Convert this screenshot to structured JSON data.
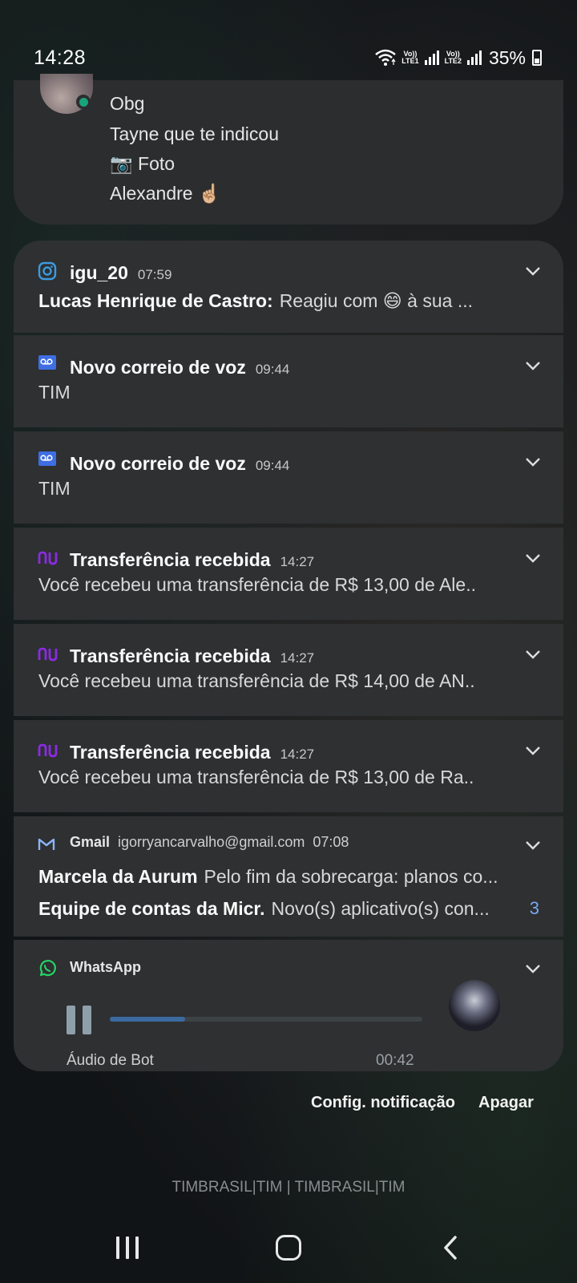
{
  "status_bar": {
    "time": "14:28",
    "lte1": "Vo))\nLTE1",
    "lte2": "Vo))\nLTE2",
    "battery": "35%"
  },
  "conversation": {
    "messages": [
      "Obg",
      "Tayne que te indicou",
      "📷 Foto",
      "Alexandre ☝🏼"
    ]
  },
  "notifications": [
    {
      "icon": "instagram-icon",
      "title": "igu_20",
      "time": "07:59",
      "sender": "Lucas Henrique de Castro:",
      "text": "Reagiu com 😄 à sua ..."
    },
    {
      "icon": "voicemail-icon",
      "title": "Novo correio de voz",
      "time": "09:44",
      "text": "TIM"
    },
    {
      "icon": "voicemail-icon",
      "title": "Novo correio de voz",
      "time": "09:44",
      "text": "TIM"
    },
    {
      "icon": "nubank-icon",
      "title": "Transferência recebida",
      "time": "14:27",
      "text": "Você recebeu uma transferência de R$ 13,00 de Ale.."
    },
    {
      "icon": "nubank-icon",
      "title": "Transferência recebida",
      "time": "14:27",
      "text": "Você recebeu uma transferência de R$ 14,00 de AN.."
    },
    {
      "icon": "nubank-icon",
      "title": "Transferência recebida",
      "time": "14:27",
      "text": "Você recebeu uma transferência de R$ 13,00 de Ra.."
    }
  ],
  "gmail": {
    "app": "Gmail",
    "account": "igorryancarvalho@gmail.com",
    "time": "07:08",
    "rows": [
      {
        "sender": "Marcela da Aurum",
        "text": "Pelo fim da sobrecarga: planos co..."
      },
      {
        "sender": "Equipe de contas da Micr.",
        "text": "Novo(s) aplicativo(s) con..."
      }
    ],
    "count": "3"
  },
  "whatsapp": {
    "app": "WhatsApp",
    "audio_label": "Áudio de Bot",
    "duration": "00:42",
    "progress": 0.24
  },
  "actions": {
    "settings": "Config. notificação",
    "clear": "Apagar"
  },
  "carrier": "TIMBRASIL|TIM | TIMBRASIL|TIM",
  "colors": {
    "card": "#2e3031",
    "nubank": "#8a2be2",
    "instagram": "#3b9ae1",
    "whatsapp": "#25d366",
    "gmail_count": "#7aa7f5"
  }
}
